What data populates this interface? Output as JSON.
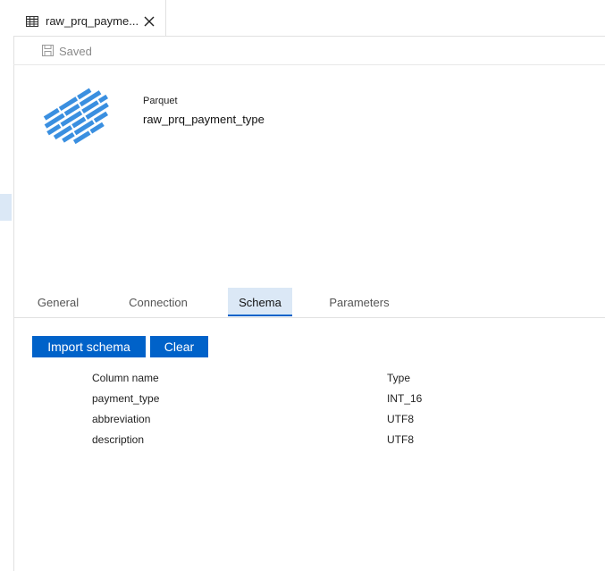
{
  "tab": {
    "title": "raw_prq_payme...",
    "icon": "table-icon",
    "close_icon": "close-icon"
  },
  "toolbar": {
    "saved_label": "Saved",
    "saved_icon": "save-icon"
  },
  "dataset": {
    "kind": "Parquet",
    "name": "raw_prq_payment_type",
    "logo": "parquet-logo"
  },
  "property_tabs": [
    {
      "label": "General",
      "active": false
    },
    {
      "label": "Connection",
      "active": false
    },
    {
      "label": "Schema",
      "active": true
    },
    {
      "label": "Parameters",
      "active": false
    }
  ],
  "schema": {
    "import_label": "Import schema",
    "clear_label": "Clear",
    "columns": {
      "name": "Column name",
      "type": "Type"
    },
    "rows": [
      {
        "name": "payment_type",
        "type": "INT_16"
      },
      {
        "name": "abbreviation",
        "type": "UTF8"
      },
      {
        "name": "description",
        "type": "UTF8"
      }
    ]
  },
  "colors": {
    "accent": "#0062c9",
    "active_tab_bg": "#dbe8f6",
    "logo": "#3a8fe0"
  }
}
